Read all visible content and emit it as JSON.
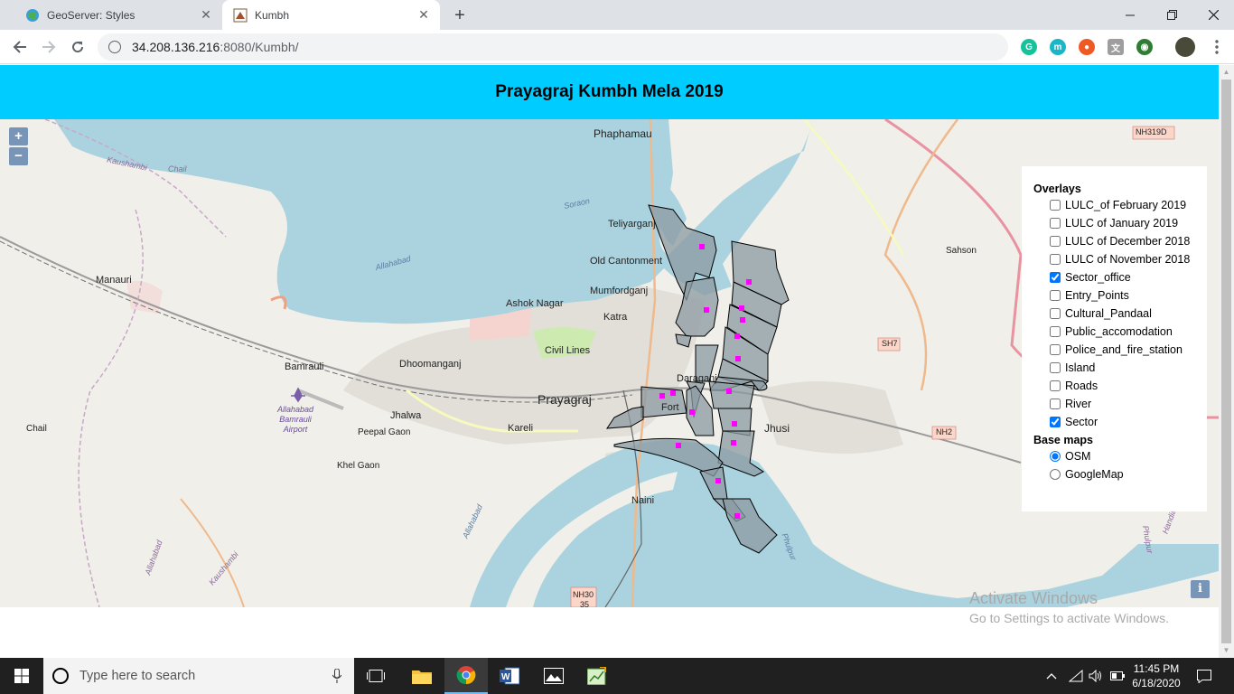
{
  "browser": {
    "tabs": [
      {
        "title": "GeoServer: Styles",
        "active": false
      },
      {
        "title": "Kumbh",
        "active": true
      }
    ],
    "url_host": "34.208.136.216",
    "url_rest": ":8080/Kumbh/",
    "window_controls": [
      "minimize-icon",
      "restore-icon",
      "close-icon"
    ]
  },
  "page": {
    "title": "Prayagraj Kumbh Mela 2019",
    "zoom_in": "+",
    "zoom_out": "−",
    "info": "i"
  },
  "layer_switcher": {
    "overlays_title": "Overlays",
    "overlays": [
      {
        "label": "LULC_of February 2019",
        "checked": false
      },
      {
        "label": "LULC of January 2019",
        "checked": false
      },
      {
        "label": "LULC of December 2018",
        "checked": false
      },
      {
        "label": "LULC of November 2018",
        "checked": false
      },
      {
        "label": "Sector_office",
        "checked": true
      },
      {
        "label": "Entry_Points",
        "checked": false
      },
      {
        "label": "Cultural_Pandaal",
        "checked": false
      },
      {
        "label": "Public_accomodation",
        "checked": false
      },
      {
        "label": "Police_and_fire_station",
        "checked": false
      },
      {
        "label": "Island",
        "checked": false
      },
      {
        "label": "Roads",
        "checked": false
      },
      {
        "label": "River",
        "checked": false
      },
      {
        "label": "Sector",
        "checked": true
      }
    ],
    "basemaps_title": "Base maps",
    "basemaps": [
      {
        "label": "OSM",
        "selected": true
      },
      {
        "label": "GoogleMap",
        "selected": false
      }
    ]
  },
  "map_labels": {
    "phaphamau": "Phaphamau",
    "teliyarganj": "Teliyarganj",
    "old_cantonment": "Old Cantonment",
    "mumfordganj": "Mumfordganj",
    "ashok_nagar": "Ashok Nagar",
    "katra": "Katra",
    "civil_lines": "Civil Lines",
    "dhoomanganj": "Dhoomanganj",
    "bamrauli": "Bamrauli",
    "prayagraj": "Prayagraj",
    "daraganj": "Daraganj",
    "fort": "Fort",
    "jhalwa": "Jhalwa",
    "karelli": "Kareli",
    "peepal_gaon": "Peepal Gaon",
    "khel_gaon": "Khel Gaon",
    "airport": "Allahabad\nBamrauli\nAirport",
    "manauri": "Manauri",
    "chail": "Chail",
    "kaushambi_top": "Kaushambi",
    "chail_top": "Chail",
    "kaushambi_bottom": "Kaushambi",
    "allahabad_bottom": "Allahabad",
    "allahabad_river": "Allahabad",
    "allahabad_river2": "Allahabad",
    "soraon": "Soraon",
    "sahson": "Sahson",
    "jhusi": "Jhusi",
    "naini": "Naini",
    "phulpur": "Phulpur",
    "phulpur2": "Phulpur",
    "handia": "Handia",
    "nh319d": "NH319D",
    "sh7": "SH7",
    "nh2": "NH2",
    "nh30": "NH30",
    "nh30_num": "35"
  },
  "watermark": {
    "line1": "Activate Windows",
    "line2": "Go to Settings to activate Windows."
  },
  "taskbar": {
    "search_placeholder": "Type here to search",
    "time": "11:45 PM",
    "date": "6/18/2020"
  },
  "colors": {
    "header_bg": "#00ccff",
    "water": "#aad3df",
    "sector_fill": "#8b9aa1",
    "sector_office": "#ff00ff",
    "map_bg": "#f0efe9"
  }
}
